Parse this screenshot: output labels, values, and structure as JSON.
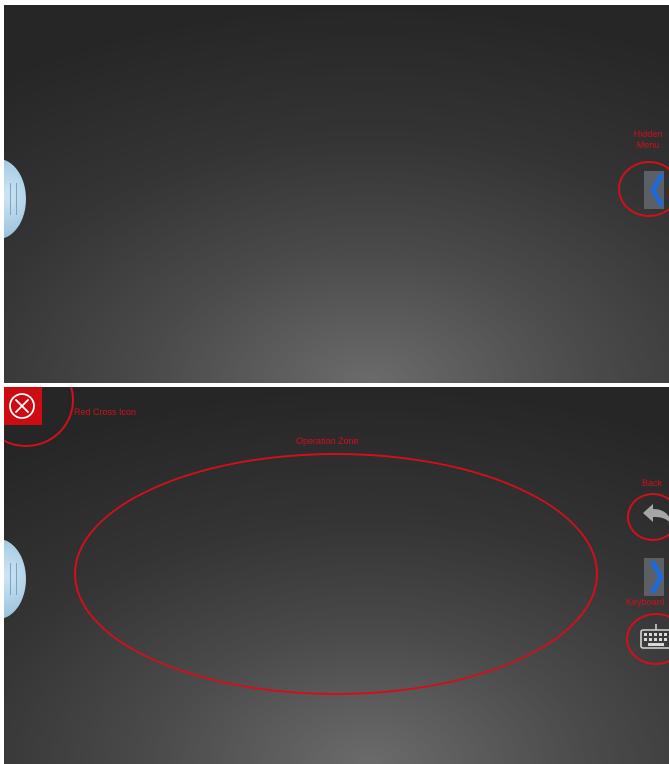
{
  "top_screen": {
    "annotation_hidden_menu": "Hidden\nMenu",
    "side_tab_icon": "chevron-left-icon",
    "colors": {
      "annotation": "#d0101a",
      "chevron": "#1e6ad8"
    }
  },
  "bottom_screen": {
    "annotation_red_cross": "Red Cross Icon",
    "annotation_operation_zone": "Operation Zone",
    "annotation_back": "Back",
    "annotation_keyboard": "Keyboard",
    "close_icon": "red-cross-icon",
    "back_icon": "back-arrow-icon",
    "side_tab_icon": "chevron-right-icon",
    "keyboard_icon": "keyboard-icon",
    "colors": {
      "close_button": "#cc0b12"
    }
  }
}
